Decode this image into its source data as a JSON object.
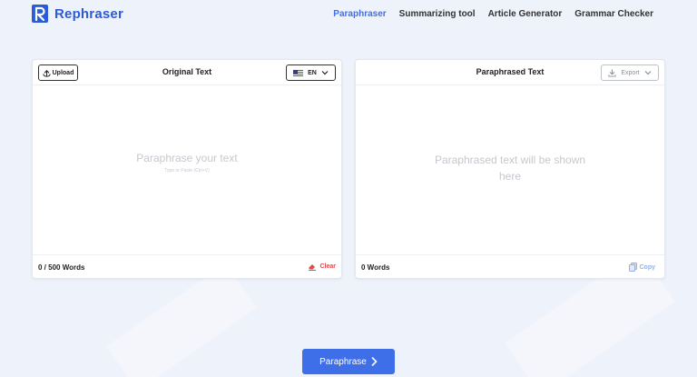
{
  "brand": {
    "name": "Rephraser",
    "accent": "#3f6fe8"
  },
  "nav": {
    "items": [
      "Paraphraser",
      "Summarizing tool",
      "Article Generator",
      "Grammar Checker"
    ],
    "active": 0
  },
  "left_panel": {
    "upload_label": "Upload",
    "title": "Original Text",
    "language": "EN",
    "placeholder_main": "Paraphrase your text",
    "placeholder_sub": "Type or Paste (Ctrl+V)",
    "word_count": "0 / 500 Words",
    "clear_label": "Clear"
  },
  "right_panel": {
    "title": "Paraphrased Text",
    "export_label": "Export",
    "placeholder": "Paraphrased text will be shown here",
    "word_count": "0 Words",
    "copy_label": "Copy"
  },
  "action": {
    "paraphrase_label": "Paraphrase"
  }
}
